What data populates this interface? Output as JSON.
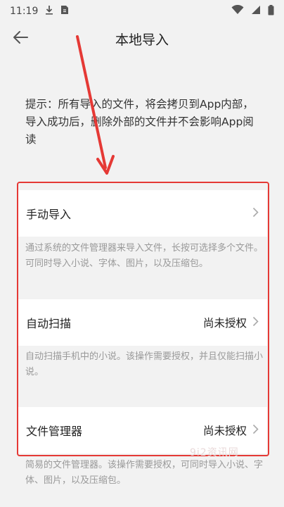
{
  "status_bar": {
    "time": "11:19"
  },
  "app_bar": {
    "title": "本地导入"
  },
  "hint": {
    "text": "提示：所有导入的文件，将会拷贝到App内部，导入成功后，删除外部的文件并不会影响App阅读"
  },
  "items": [
    {
      "label": "手动导入",
      "status": "",
      "desc": "通过系统的文件管理器来导入文件，长按可选择多个文件。可同时导入小说、字体、图片，以及压缩包。"
    },
    {
      "label": "自动扫描",
      "status": "尚未授权",
      "desc": "自动扫描手机中的小说。该操作需要授权，并且仅能扫描小说。"
    },
    {
      "label": "文件管理器",
      "status": "尚未授权",
      "desc": "简易的文件管理器。该操作需要授权，可同时导入小说、字体、图片，以及压缩包。"
    }
  ],
  "watermark": "9i2资讯网",
  "colors": {
    "annotation": "#e53935",
    "background": "#f2f2f2",
    "desc_text": "#999999"
  },
  "icons": [
    "download-icon",
    "file-icon",
    "wifi-icon",
    "signal-icon",
    "battery-icon",
    "back-arrow-icon",
    "chevron-right-icon"
  ]
}
